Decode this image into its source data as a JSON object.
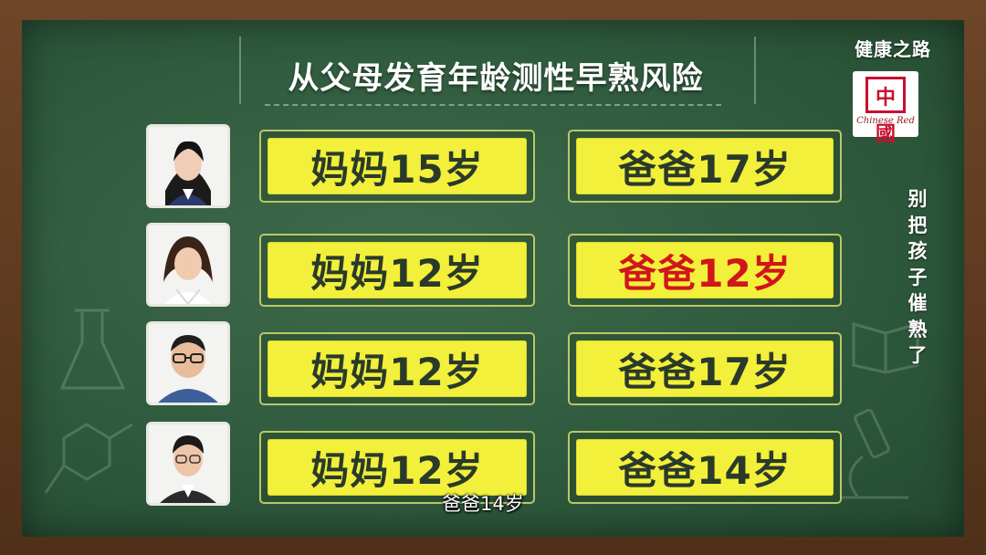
{
  "title": "从父母发育年龄测性早熟风险",
  "channel": "健康之路",
  "logo": {
    "seal_text": "中國",
    "text": "Chinese Red"
  },
  "side_text": [
    "别",
    "把",
    "孩",
    "子",
    "催",
    "熟",
    "了"
  ],
  "rows": [
    {
      "mother": "妈妈15岁",
      "father": "爸爸17岁",
      "father_highlight": false
    },
    {
      "mother": "妈妈12岁",
      "father": "爸爸12岁",
      "father_highlight": true
    },
    {
      "mother": "妈妈12岁",
      "father": "爸爸17岁",
      "father_highlight": false
    },
    {
      "mother": "妈妈12岁",
      "father": "爸爸14岁",
      "father_highlight": false
    }
  ],
  "caption": "爸爸14岁",
  "colors": {
    "board": "#2f5a3d",
    "card": "#f2f03a",
    "highlight": "#d0161b",
    "frame": "#5b3a22"
  }
}
